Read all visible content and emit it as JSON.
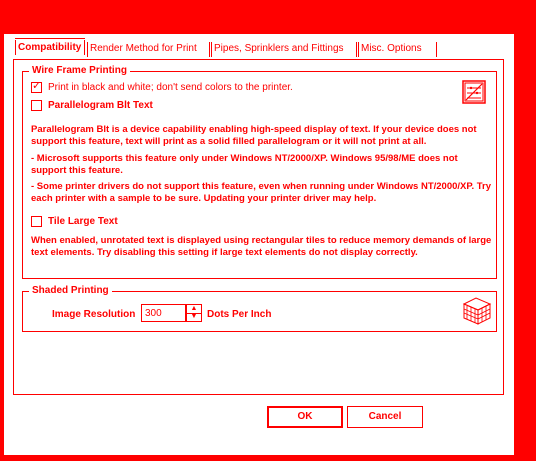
{
  "tabs": [
    {
      "label": "Compatibility",
      "active": true
    },
    {
      "label": "Render Method for Print",
      "active": false
    },
    {
      "label": "Pipes, Sprinklers and Fittings",
      "active": false
    },
    {
      "label": "Misc. Options",
      "active": false
    }
  ],
  "wire_frame": {
    "title": "Wire Frame Printing",
    "print_bw_label": "Print in black and white; don't send colors to the printer.",
    "print_bw_checked": true,
    "parallelogram_label": "Parallelogram Blt Text",
    "parallelogram_checked": false,
    "desc1": "Parallelogram Blt is a device capability enabling high-speed display of text. If your device does not support this feature, text will print as a solid filled parallelogram or it will not print at all.",
    "desc2": " - Microsoft supports this feature only under Windows NT/2000/XP. Windows 95/98/ME does not support this feature.",
    "desc3": " - Some printer drivers do not support this feature, even when running under Windows NT/2000/XP. Try each printer with a sample to be sure. Updating your printer driver may help.",
    "tile_large_label": "Tile Large Text",
    "tile_large_checked": false,
    "desc4": "When enabled, unrotated text is displayed using rectangular tiles to reduce memory demands of large text elements.  Try disabling this setting if large text elements do not display correctly."
  },
  "shaded": {
    "title": "Shaded Printing",
    "image_resolution_label": "Image Resolution",
    "image_resolution_value": "300",
    "units_label": "Dots Per Inch"
  },
  "buttons": {
    "ok": "OK",
    "cancel": "Cancel"
  },
  "icons": {
    "wire_frame_icon": "wireframe-print-icon",
    "shaded_icon": "shaded-print-icon"
  },
  "colors": {
    "accent": "#ff0000",
    "background": "#ffffff"
  }
}
